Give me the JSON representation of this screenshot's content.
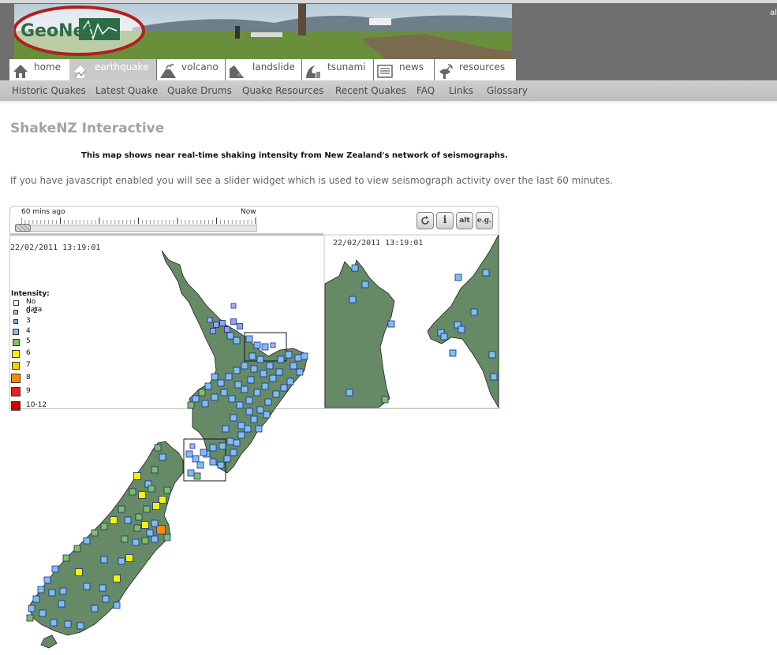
{
  "site": {
    "logo_text": "GeoNet",
    "corner_text": "al"
  },
  "tabs": [
    {
      "label": "home",
      "icon": "house-icon"
    },
    {
      "label": "earthquake",
      "icon": "earthquake-icon",
      "active": true
    },
    {
      "label": "volcano",
      "icon": "volcano-icon"
    },
    {
      "label": "landslide",
      "icon": "landslide-icon"
    },
    {
      "label": "tsunami",
      "icon": "tsunami-icon"
    },
    {
      "label": "news",
      "icon": "newspaper-icon"
    },
    {
      "label": "resources",
      "icon": "satellite-dish-icon"
    }
  ],
  "subnav": [
    "Historic Quakes",
    "Latest Quake",
    "Quake Drums",
    "Quake Resources",
    "Recent Quakes",
    "FAQ",
    "Links",
    "Glossary"
  ],
  "page": {
    "title": "ShakeNZ Interactive",
    "description_bold": "This map shows near real-time shaking intensity from New Zealand's network of seismographs.",
    "description": "If you have javascript enabled you will see a slider widget which is used to view seismograph activity over the last 60 minutes."
  },
  "slider": {
    "start_label": "60 mins ago",
    "end_label": "Now",
    "position": 0
  },
  "buttons": [
    {
      "label": "",
      "icon": "refresh-icon"
    },
    {
      "label": "i",
      "icon": "info-icon"
    },
    {
      "label": "alt",
      "icon": "alt-icon"
    },
    {
      "label": "e.g.",
      "icon": "example-icon"
    }
  ],
  "map": {
    "timestamp": "22/02/2011 13:19:01",
    "inset_timestamp": "22/02/2011 13:19:01",
    "land_color": "#668a66",
    "legend_title": "Intensity:",
    "legend": [
      {
        "label": "No data",
        "color": "#ffffff"
      },
      {
        "label": "0-2",
        "color": "#aab4ff"
      },
      {
        "label": "3",
        "color": "#8fa4f0"
      },
      {
        "label": "4",
        "color": "#7fbef0"
      },
      {
        "label": "5",
        "color": "#7fbf5f"
      },
      {
        "label": "6",
        "color": "#f4f400"
      },
      {
        "label": "7",
        "color": "#ffd000"
      },
      {
        "label": "8",
        "color": "#ff8c00"
      },
      {
        "label": "9",
        "color": "#ee2020"
      },
      {
        "label": "10-12",
        "color": "#cc0000"
      }
    ]
  }
}
